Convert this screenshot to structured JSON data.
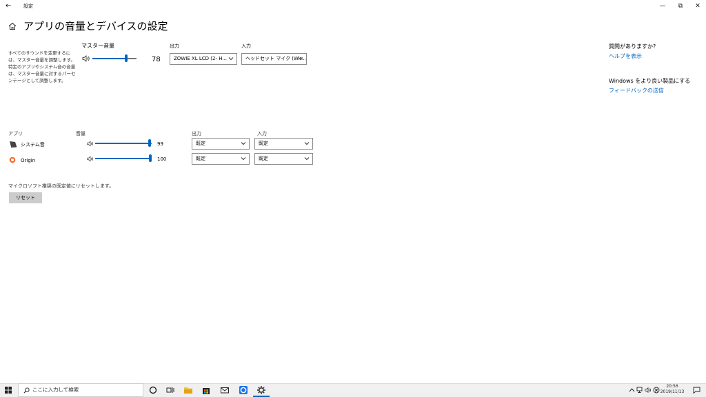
{
  "window": {
    "title": "設定",
    "back_glyph": "←",
    "minimize_glyph": "—",
    "maximize_glyph": "⧉",
    "close_glyph": "✕"
  },
  "page": {
    "title": "アプリの音量とデバイスの設定"
  },
  "description": "すべてのサウンドを変更するには、マスター音量を調整します。特定のアプリやシステム音の音量は、マスター音量に対するパーセンテージとして調整します。",
  "master": {
    "label": "マスター音量",
    "value": "78",
    "level": 0.78,
    "output_label": "出力",
    "output_value": "ZOWIE XL LCD (2- H...",
    "input_label": "入力",
    "input_value": "ヘッドセット マイク (Wir..."
  },
  "help": {
    "question": "質問がありますか?",
    "help_link": "ヘルプを表示",
    "improve": "Windows をより良い製品にする",
    "feedback_link": "フィードバックの送信"
  },
  "apps_table": {
    "app_header": "アプリ",
    "volume_header": "音量",
    "output_header": "出力",
    "input_header": "入力",
    "rows": [
      {
        "name": "システム音",
        "icon": "system-sounds-icon",
        "volume": "99",
        "level": 0.99,
        "output": "既定",
        "input": "既定"
      },
      {
        "name": "Origin",
        "icon": "origin-icon",
        "volume": "100",
        "level": 1.0,
        "output": "既定",
        "input": "既定"
      }
    ]
  },
  "reset": {
    "text": "マイクロソフト推奨の既定値にリセットします。",
    "button": "リセット"
  },
  "taskbar": {
    "search_placeholder": "ここに入力して検索",
    "time": "20:56",
    "date": "2019/11/13",
    "active_app": "settings"
  },
  "colors": {
    "accent": "#0067c0",
    "reset_button": "#cccccc",
    "origin": "#f56c2d"
  }
}
